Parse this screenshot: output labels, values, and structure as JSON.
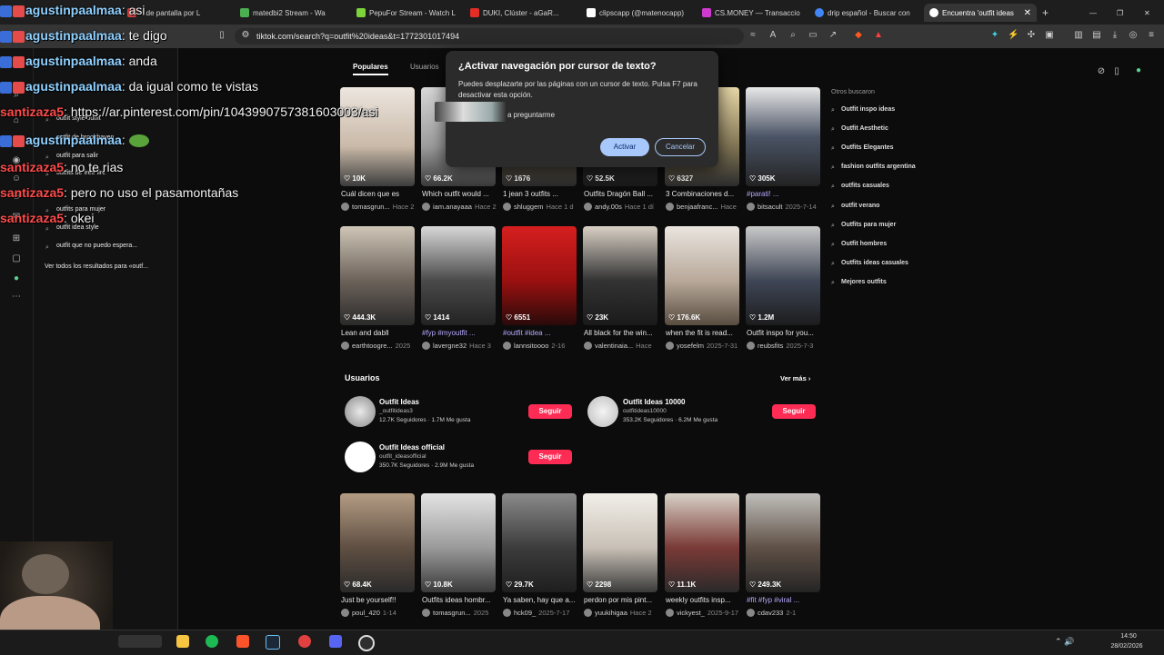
{
  "browser": {
    "tabs": [
      {
        "label": "...de pantalla por L",
        "color": "#d04040"
      },
      {
        "label": "matedbi2 Stream - Wa",
        "color": "#4caf50"
      },
      {
        "label": "PepuFor Stream - Watch L",
        "color": "#7cd33a"
      },
      {
        "label": "DUKI, Clúster - aGaR...",
        "color": "#e52d27"
      },
      {
        "label": "clipscapp (@matenocapp)",
        "color": "#ffffff"
      },
      {
        "label": "CS.MONEY — Transaccio",
        "color": "#d03ad0"
      },
      {
        "label": "drip español - Buscar con",
        "color": "#4285f4"
      },
      {
        "label": "Encuentra 'outfit ideas",
        "color": "#ffffff"
      }
    ],
    "url": "tiktok.com/search?q=outfit%20ideas&t=1772301017494"
  },
  "search_panel": {
    "suggestions": [
      "outfit style outfit",
      "outfit de brookhaven",
      "outfit para salir",
      "outfits de free fire",
      "outfits para mujer",
      "outfit idea style",
      "outfit que no puedo espera..."
    ],
    "see_all": "Ver todos los resultados para «outf..."
  },
  "main": {
    "tabs": [
      "Populares",
      "Usuarios"
    ],
    "row1": [
      {
        "likes": "10K",
        "caption": "Cuál dicen que es",
        "author": "tomasgrun...",
        "time": "Hace 2"
      },
      {
        "likes": "66.2K",
        "caption": "Which outfit would ...",
        "author": "iam.anayaaa",
        "time": "Hace 2"
      },
      {
        "likes": "1676",
        "caption": "1 jean 3 outfits ...",
        "author": "shluggem",
        "time": "Hace 1 d"
      },
      {
        "likes": "52.5K",
        "caption": "Outfits Dragón Ball ...",
        "author": "andy.00s",
        "time": "Hace 1 dí"
      },
      {
        "likes": "6327",
        "caption": "3 Combinaciones d...",
        "author": "benjaafranc...",
        "time": "Hace"
      },
      {
        "likes": "305K",
        "caption": "#parati! ...",
        "author": "bitsacult",
        "time": "2025-7-14"
      }
    ],
    "row2": [
      {
        "likes": "444.3K",
        "caption": "Lean and dabll",
        "author": "earthtoogre...",
        "time": "2025"
      },
      {
        "likes": "1414",
        "caption": "#fyp #myoutfit ...",
        "author": "lavergne32",
        "time": "Hace 3"
      },
      {
        "likes": "6551",
        "caption": "#outfit #idea ...",
        "author": "lannsitoooo",
        "time": "2-16"
      },
      {
        "likes": "23K",
        "caption": "All black for the win...",
        "author": "valentinaia...",
        "time": "Hace"
      },
      {
        "likes": "176.6K",
        "caption": "when the fit is read...",
        "author": "yosefelm",
        "time": "2025-7-31"
      },
      {
        "likes": "1.2M",
        "caption": "Outfit inspo for you...",
        "author": "reubsfits",
        "time": "2025-7-3"
      }
    ],
    "users_heading": "Usuarios",
    "see_more": "Ver más",
    "users": [
      {
        "name": "Outfit Ideas",
        "handle": "_outfitideas3",
        "stats": "12.7K Seguidores · 1.7M Me gusta",
        "follow": "Seguir"
      },
      {
        "name": "Outfit Ideas 10000",
        "handle": "outfitideas10000",
        "stats": "353.2K Seguidores · 6.2M Me gusta",
        "follow": "Seguir"
      },
      {
        "name": "Outfit Ideas official",
        "handle": "outfit_ideasofficial",
        "stats": "350.7K Seguidores · 2.9M Me gusta",
        "follow": "Seguir"
      }
    ],
    "row3": [
      {
        "likes": "68.4K",
        "caption": "Just be yourself!!",
        "author": "poul_420",
        "time": "1-14"
      },
      {
        "likes": "10.8K",
        "caption": "Outfits ideas hombr...",
        "author": "tomasgrun...",
        "time": "2025"
      },
      {
        "likes": "29.7K",
        "caption": "Ya saben, hay que a...",
        "author": "hck09_",
        "time": "2025-7-17"
      },
      {
        "likes": "2298",
        "caption": "perdon por mis pint...",
        "author": "yuukihigaa",
        "time": "Hace 2"
      },
      {
        "likes": "11.1K",
        "caption": "weekly outfits insp...",
        "author": "vickyest_",
        "time": "2025-9-17"
      },
      {
        "likes": "249.3K",
        "caption": "#fit #fyp #viral ...",
        "author": "cdav233",
        "time": "2-1"
      }
    ],
    "related_heading": "Otros buscaron",
    "related": [
      "Outfit inspo ideas",
      "Outfit Aesthetic",
      "Outfits Elegantes",
      "fashion outfits argentina",
      "outfits casuales",
      "outfit verano",
      "Outfits para mujer",
      "Outfit hombres",
      "Outfits ideas casuales",
      "Mejores outfits"
    ]
  },
  "dialog": {
    "title": "¿Activar navegación por cursor de texto?",
    "text": "Puedes desplazarte por las páginas con un cursor de texto. Pulsa F7 para desactivar esta opción.",
    "checkbox": "a preguntarme",
    "activate": "Activar",
    "cancel": "Cancelar"
  },
  "chat": [
    {
      "user": "agustinpaalmaa",
      "msg": "asi",
      "color": "#8fd0ff"
    },
    {
      "user": "agustinpaalmaa",
      "msg": "te digo",
      "color": "#8fd0ff"
    },
    {
      "user": "agustinpaalmaa",
      "msg": "anda",
      "color": "#8fd0ff"
    },
    {
      "user": "agustinpaalmaa",
      "msg": "da igual como te vistas",
      "color": "#8fd0ff"
    },
    {
      "user": "santizaza5",
      "msg": "https://ar.pinterest.com/pin/1043990757381603003/asi",
      "color": "#ff4b4b"
    },
    {
      "user": "agustinpaalmaa",
      "msg": "",
      "color": "#8fd0ff"
    },
    {
      "user": "santizaza5",
      "msg": "no te rias",
      "color": "#ff4b4b"
    },
    {
      "user": "santizaza5",
      "msg": "pero no uso el pasamontañas",
      "color": "#ff4b4b"
    },
    {
      "user": "santizaza5",
      "msg": "okei",
      "color": "#ff4b4b"
    }
  ],
  "taskbar": {
    "time": "14:50",
    "date": "28/02/2026"
  }
}
